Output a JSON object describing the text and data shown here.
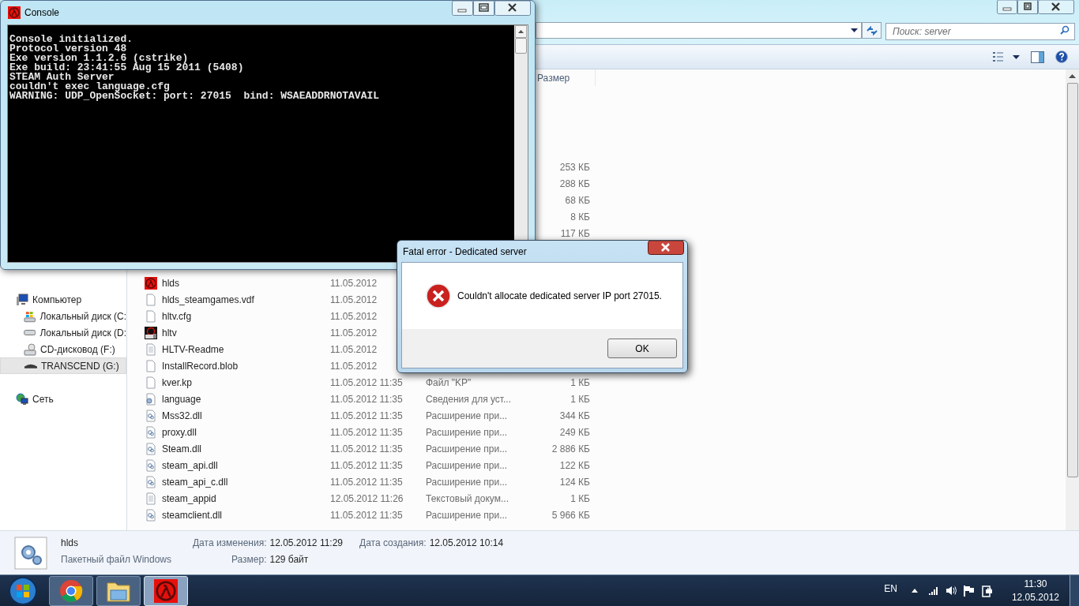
{
  "explorer": {
    "search_placeholder": "Поиск: server",
    "size_header": "Размер",
    "sidebar": [
      {
        "label": "Компьютер",
        "kind": "computer",
        "selected": false,
        "children": [
          {
            "label": "Локальный диск (C:",
            "kind": "windisk",
            "selected": false
          },
          {
            "label": "Локальный диск (D:",
            "kind": "disk",
            "selected": false
          },
          {
            "label": "CD-дисковод (F:)",
            "kind": "cd",
            "selected": false
          },
          {
            "label": "TRANSCEND (G:)",
            "kind": "usb",
            "selected": true
          }
        ]
      },
      {
        "label": "Сеть",
        "kind": "network",
        "selected": false
      }
    ],
    "rows_upper": [
      {
        "size": "253 КБ"
      },
      {
        "size": "288 КБ"
      },
      {
        "size": "68 КБ"
      },
      {
        "size": "8 КБ"
      },
      {
        "size": "117 КБ"
      }
    ],
    "rows": [
      {
        "name": "hlds",
        "kind": "hl",
        "date": "11.05.2012"
      },
      {
        "name": "hlds_steamgames.vdf",
        "kind": "blank",
        "date": "11.05.2012"
      },
      {
        "name": "hltv.cfg",
        "kind": "blank",
        "date": "11.05.2012"
      },
      {
        "name": "hltv",
        "kind": "hltv",
        "date": "11.05.2012"
      },
      {
        "name": "HLTV-Readme",
        "kind": "text",
        "date": "11.05.2012"
      },
      {
        "name": "InstallRecord.blob",
        "kind": "blank",
        "date": "11.05.2012"
      },
      {
        "name": "kver.kp",
        "kind": "blank",
        "date": "11.05.2012 11:35",
        "type": "Файл \"KP\"",
        "size": "1 КБ"
      },
      {
        "name": "language",
        "kind": "settings",
        "date": "11.05.2012 11:35",
        "type": "Сведения для уст...",
        "size": "1 КБ"
      },
      {
        "name": "Mss32.dll",
        "kind": "dll",
        "date": "11.05.2012 11:35",
        "type": "Расширение при...",
        "size": "344 КБ"
      },
      {
        "name": "proxy.dll",
        "kind": "dll",
        "date": "11.05.2012 11:35",
        "type": "Расширение при...",
        "size": "249 КБ"
      },
      {
        "name": "Steam.dll",
        "kind": "dll",
        "date": "11.05.2012 11:35",
        "type": "Расширение при...",
        "size": "2 886 КБ"
      },
      {
        "name": "steam_api.dll",
        "kind": "dll",
        "date": "11.05.2012 11:35",
        "type": "Расширение при...",
        "size": "122 КБ"
      },
      {
        "name": "steam_api_c.dll",
        "kind": "dll",
        "date": "11.05.2012 11:35",
        "type": "Расширение при...",
        "size": "124 КБ"
      },
      {
        "name": "steam_appid",
        "kind": "text",
        "date": "12.05.2012 11:26",
        "type": "Текстовый докум...",
        "size": "1 КБ"
      },
      {
        "name": "steamclient.dll",
        "kind": "dll",
        "date": "11.05.2012 11:35",
        "type": "Расширение при...",
        "size": "5 966 КБ"
      }
    ],
    "details": {
      "name": "hlds",
      "type": "Пакетный файл Windows",
      "modified_label": "Дата изменения:",
      "modified": "12.05.2012 11:29",
      "created_label": "Дата создания:",
      "created": "12.05.2012 10:14",
      "size_label": "Размер:",
      "size": "129 байт"
    }
  },
  "console": {
    "title": "Console",
    "lines": [
      "Console initialized.",
      "Protocol version 48",
      "Exe version 1.1.2.6 (cstrike)",
      "Exe build: 23:41:55 Aug 15 2011 (5408)",
      "STEAM Auth Server",
      "couldn't exec language.cfg",
      "WARNING: UDP_OpenSocket: port: 27015  bind: WSAEADDRNOTAVAIL"
    ]
  },
  "dialog": {
    "title": "Fatal error - Dedicated server",
    "message": "Couldn't allocate dedicated server IP port 27015.",
    "button": "OK"
  },
  "taskbar": {
    "apps": [
      {
        "kind": "chrome",
        "selected": false
      },
      {
        "kind": "explorer",
        "selected": false
      },
      {
        "kind": "hl",
        "selected": true
      }
    ],
    "language": "EN",
    "time": "11:30",
    "date": "12.05.2012"
  }
}
